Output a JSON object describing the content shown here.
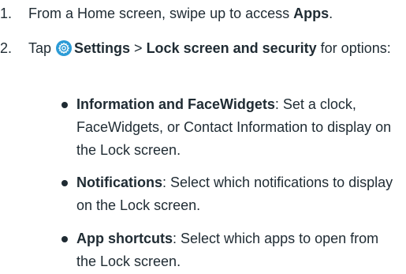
{
  "steps": [
    {
      "number": "1.",
      "pre": "From a Home screen, swipe up to access ",
      "bold": "Apps",
      "post": "."
    },
    {
      "number": "2.",
      "pre": "Tap ",
      "icon": "settings-gear-icon",
      "bold1": "Settings",
      "sep": " > ",
      "bold2": "Lock screen and security",
      "post": " for options:"
    }
  ],
  "bullets": [
    {
      "title": "Information and FaceWidgets",
      "desc": ": Set a clock, FaceWidgets, or Contact Information to display on the Lock screen."
    },
    {
      "title": "Notifications",
      "desc": ": Select which notifications to display on the Lock screen."
    },
    {
      "title": "App shortcuts",
      "desc": ": Select which apps to open from the Lock screen."
    }
  ],
  "colors": {
    "text": "#1f2b33",
    "settings_icon": "#2c9bd6"
  }
}
